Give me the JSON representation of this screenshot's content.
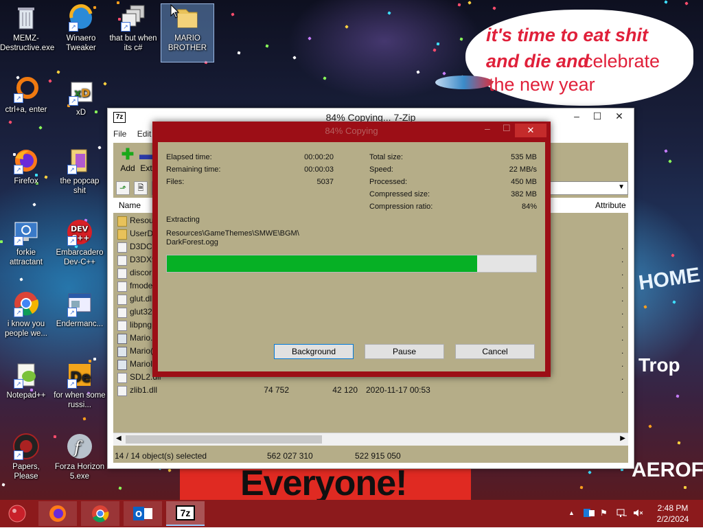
{
  "desktop": {
    "icons": [
      {
        "label": "MEMZ-Destructive.exe",
        "icon": "recycle-bin-icon"
      },
      {
        "label": "Winaero Tweaker",
        "icon": "winaero-icon"
      },
      {
        "label": "that but when its c#",
        "icon": "windows-stack-icon"
      },
      {
        "label": "MARIO BROTHER",
        "icon": "folder-icon"
      },
      {
        "label": "ctrl+a, enter",
        "icon": "ring-icon"
      },
      {
        "label": "xD",
        "icon": "hxd-icon"
      },
      {
        "label": "Firefox",
        "icon": "firefox-icon"
      },
      {
        "label": "the popcap shit",
        "icon": "popcap-icon"
      },
      {
        "label": "forkie attractant",
        "icon": "monitor-gear-icon"
      },
      {
        "label": "Embarcadero Dev-C++",
        "icon": "devcpp-icon"
      },
      {
        "label": "i know you people we...",
        "icon": "chrome-icon"
      },
      {
        "label": "Endermanc...",
        "icon": "window-app-icon"
      },
      {
        "label": "Notepad++",
        "icon": "notepadpp-icon"
      },
      {
        "label": "for when some russi...",
        "icon": "de-icon"
      },
      {
        "label": "Papers, Please",
        "icon": "papers-please-icon"
      },
      {
        "label": "Forza Horizon 5.exe",
        "icon": "flash-icon"
      }
    ],
    "speech_bubble": {
      "line1": "it's time to eat shit",
      "line2a": "and die and",
      "line2b": "celebrate",
      "line3": "the new year"
    },
    "banner": "Everyone!",
    "wallpaper_words": {
      "aero": "AEROFOS",
      "trop": "Trop",
      "home": "HOME"
    }
  },
  "main_window": {
    "title": "84% Copying... 7-Zip",
    "app_icon": "7z",
    "menu": [
      "File",
      "Edit"
    ],
    "toolbar": [
      {
        "label": "Add",
        "icon": "plus-icon"
      },
      {
        "label": "Ext",
        "icon": "minus-icon"
      }
    ],
    "columns": {
      "name": "Name",
      "attributes": "Attribute"
    },
    "files": [
      {
        "name": "Resour",
        "icon": "folder-icon",
        "size": "",
        "packed": "",
        "modified": "",
        "attr": ""
      },
      {
        "name": "UserDa",
        "icon": "folder-icon",
        "size": "",
        "packed": "",
        "modified": "",
        "attr": ""
      },
      {
        "name": "D3DCo",
        "icon": "file-icon",
        "size": "",
        "packed": "",
        "modified": "",
        "attr": "."
      },
      {
        "name": "D3DX9",
        "icon": "file-icon",
        "size": "",
        "packed": "",
        "modified": "",
        "attr": "."
      },
      {
        "name": "discor",
        "icon": "file-icon",
        "size": "",
        "packed": "",
        "modified": "",
        "attr": "."
      },
      {
        "name": "fmode",
        "icon": "file-icon",
        "size": "",
        "packed": "",
        "modified": "",
        "attr": "."
      },
      {
        "name": "glut.dl",
        "icon": "file-icon",
        "size": "",
        "packed": "",
        "modified": "",
        "attr": "."
      },
      {
        "name": "glut32",
        "icon": "file-icon",
        "size": "",
        "packed": "",
        "modified": "",
        "attr": "."
      },
      {
        "name": "libpng",
        "icon": "file-icon",
        "size": "",
        "packed": "",
        "modified": "",
        "attr": "."
      },
      {
        "name": "Mario.",
        "icon": "exe-icon",
        "size": "",
        "packed": "",
        "modified": "",
        "attr": "."
      },
      {
        "name": "Mario(",
        "icon": "exe-icon",
        "size": "",
        "packed": "",
        "modified": "",
        "attr": "."
      },
      {
        "name": "MarioI",
        "icon": "exe-icon",
        "size": "",
        "packed": "",
        "modified": "",
        "attr": "."
      },
      {
        "name": "SDL2.dll",
        "icon": "file-icon",
        "size": "",
        "packed": "",
        "modified": "",
        "attr": "."
      },
      {
        "name": "zlib1.dll",
        "icon": "file-icon",
        "size": "74 752",
        "packed": "42 120",
        "modified": "2020-11-17 00:53",
        "attr": "."
      }
    ],
    "status": {
      "selection": "14 / 14 object(s) selected",
      "size": "562 027 310",
      "packed": "522 915 050"
    }
  },
  "progress_dialog": {
    "title": "84% Copying",
    "close": "✕",
    "left_stats": [
      {
        "label": "Elapsed time:",
        "value": "00:00:20"
      },
      {
        "label": "Remaining time:",
        "value": "00:00:03"
      },
      {
        "label": "Files:",
        "value": "5037"
      }
    ],
    "right_stats": [
      {
        "label": "Total size:",
        "value": "535 MB"
      },
      {
        "label": "Speed:",
        "value": "22 MB/s"
      },
      {
        "label": "Processed:",
        "value": "450 MB"
      },
      {
        "label": "Compressed size:",
        "value": "382 MB"
      },
      {
        "label": "Compression ratio:",
        "value": "84%"
      }
    ],
    "operation": "Extracting",
    "path_line1": "Resources\\GameThemes\\SMWE\\BGM\\",
    "path_line2": "DarkForest.ogg",
    "progress_fraction": 0.84,
    "buttons": {
      "background": "Background",
      "pause": "Pause",
      "cancel": "Cancel"
    }
  },
  "taskbar": {
    "items": [
      {
        "icon": "start-orb-icon"
      },
      {
        "icon": "firefox-icon"
      },
      {
        "icon": "chrome-icon"
      },
      {
        "icon": "outlook-icon"
      },
      {
        "icon": "7zip-icon",
        "label": "7z"
      }
    ],
    "tray_icons": [
      "chevron-up-icon",
      "outlook-icon",
      "flag-icon",
      "network-icon",
      "volume-muted-icon"
    ],
    "time": "2:48 PM",
    "date": "2/2/2024"
  },
  "colors": {
    "taskbar": "#8c1a1c",
    "dialog_frame": "#9c0e16",
    "dialog_bg": "#b5ad88",
    "progress": "#06b025",
    "bubble_text": "#e0203a"
  }
}
